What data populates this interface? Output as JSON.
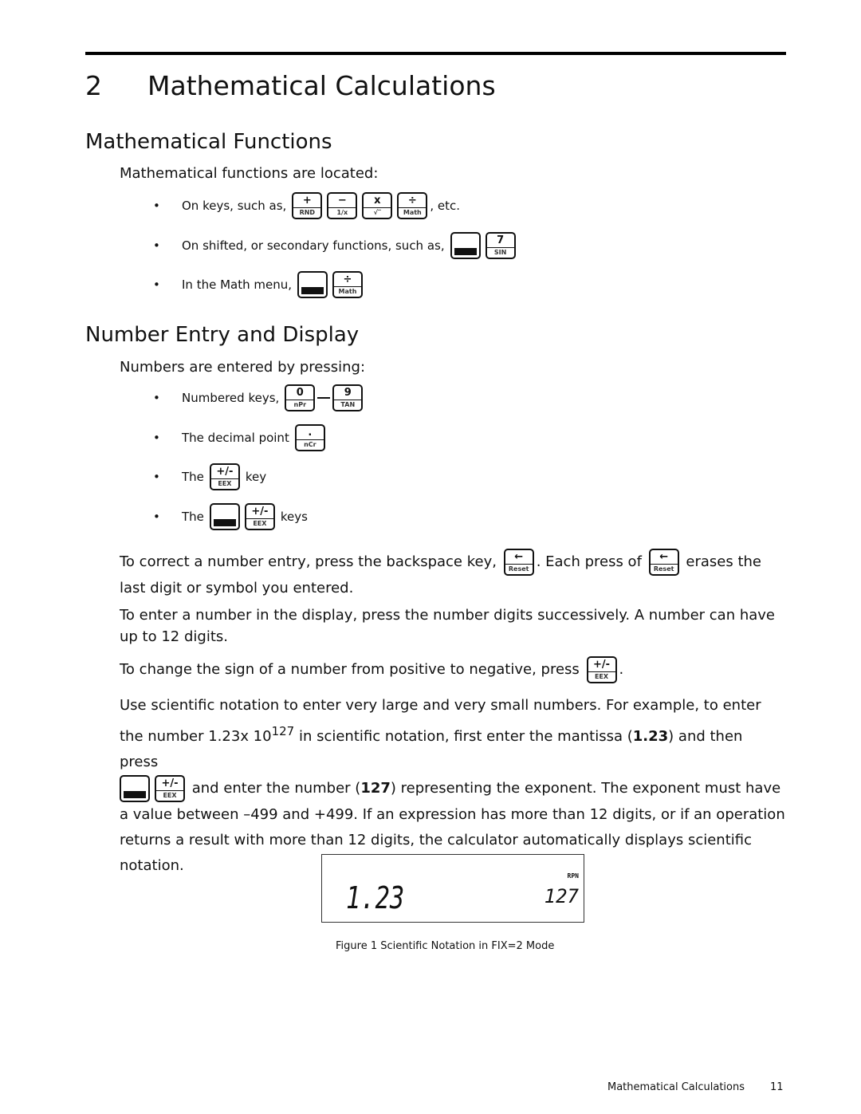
{
  "chapter": {
    "number": "2",
    "title": "Mathematical Calculations"
  },
  "section1": {
    "title": "Mathematical Functions",
    "intro": "Mathematical functions are located:",
    "bullets": [
      {
        "text": "On keys, such as,",
        "after": ", etc.",
        "keys": [
          {
            "top": "+",
            "bottom": "RND"
          },
          {
            "top": "−",
            "bottom": "1/x"
          },
          {
            "top": "x",
            "bottom": "√‾"
          },
          {
            "top": "÷",
            "bottom": "Math"
          }
        ]
      },
      {
        "text": "On shifted, or secondary functions, such as,",
        "keys": [
          {
            "top": "",
            "bottom": "",
            "type": "shift"
          },
          {
            "top": "7",
            "bottom": "SIN"
          }
        ]
      },
      {
        "text": "In the Math menu,",
        "keys": [
          {
            "top": "",
            "bottom": "",
            "type": "shift"
          },
          {
            "top": "÷",
            "bottom": "Math"
          }
        ]
      }
    ]
  },
  "section2": {
    "title": "Number Entry and Display",
    "intro": "Numbers are entered by pressing:",
    "bullets": [
      {
        "text": "Numbered keys,",
        "keys": [
          {
            "top": "0",
            "bottom": "nPr"
          },
          {
            "top": "9",
            "bottom": "TAN"
          }
        ]
      },
      {
        "text": "The decimal point",
        "keys": [
          {
            "top": ".",
            "bottom": "nCr"
          }
        ]
      },
      {
        "text": "The",
        "after": "key",
        "keys": [
          {
            "top": "+/-",
            "bottom": "EEX"
          }
        ]
      },
      {
        "text": "The",
        "after": "keys",
        "keys": [
          {
            "top": "",
            "bottom": "",
            "type": "shift"
          },
          {
            "top": "+/-",
            "bottom": "EEX"
          }
        ]
      }
    ],
    "p1a": "To correct a number entry, press the backspace key,",
    "p1b": ". Each press of",
    "p1c": "erases the last digit or symbol you entered.",
    "backspace_key": {
      "top": "←",
      "bottom": "Reset"
    },
    "p2": "To enter a number in the display, press the number digits successively. A number can have up to 12 digits.",
    "p3": "To change the sign of a number from positive to negative, press",
    "p4a": "Use scientific notation to enter very large and very small numbers. For example, to enter the number 1.23x 10",
    "p4sup": "127",
    "p4b": " in scientific notation, first enter the mantissa (",
    "p4bold1": "1.23",
    "p4c": ") and then press",
    "p4d": "and enter the number (",
    "p4bold2": "127",
    "p4e": ") representing the exponent. The exponent must have a value between –499 and +499. If an expression has more than 12 digits, or if an operation returns a result with more than 12 digits, the calculator automatically displays scientific notation."
  },
  "figure": {
    "mantissa": "1.23",
    "exponent": "127",
    "indicator": "RPN",
    "caption": "Figure 1  Scientific Notation in FIX=2 Mode"
  },
  "footer": {
    "title": "Mathematical Calculations",
    "page": "11"
  }
}
